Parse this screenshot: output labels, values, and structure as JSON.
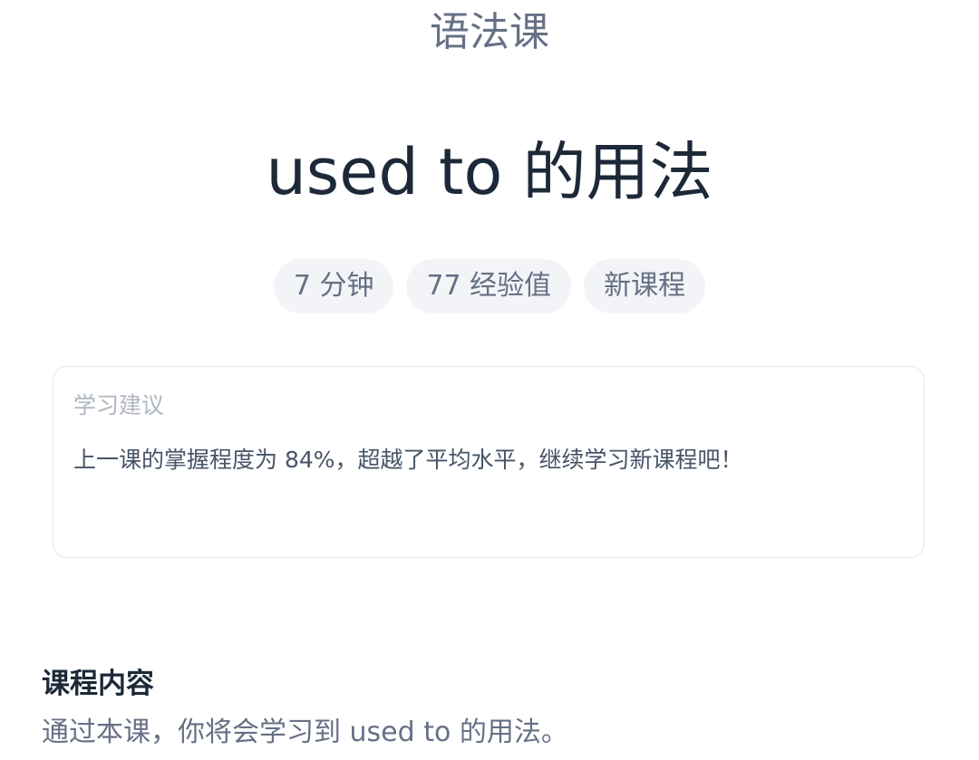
{
  "header": {
    "category": "语法课",
    "title": "used to 的用法"
  },
  "badges": [
    {
      "label": "7 分钟"
    },
    {
      "label": "77 经验值"
    },
    {
      "label": "新课程"
    }
  ],
  "advice": {
    "label": "学习建议",
    "text": "上一课的掌握程度为 84%，超越了平均水平，继续学习新课程吧！"
  },
  "content": {
    "title": "课程内容",
    "text": "通过本课，你将会学习到 used to 的用法。"
  },
  "colors": {
    "badge_background": "#f2f4f7",
    "title": "#1d2939",
    "muted_text": "#667085"
  }
}
